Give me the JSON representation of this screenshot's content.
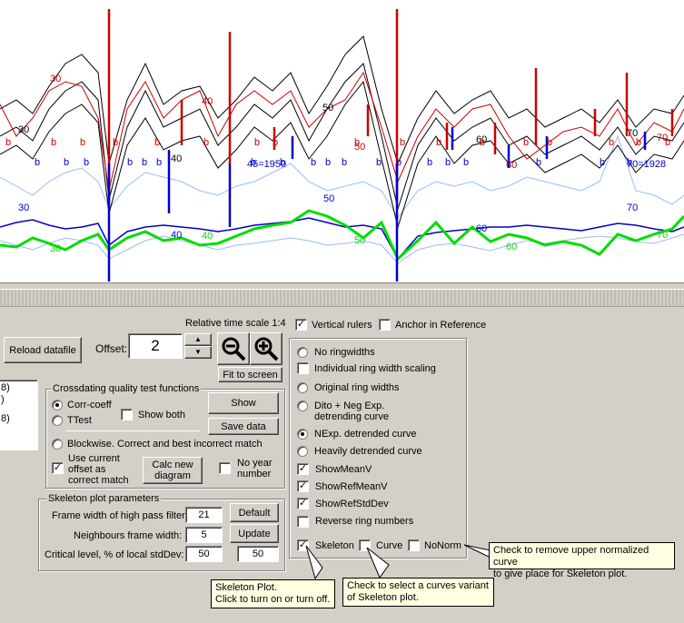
{
  "chart_data": {
    "type": "line",
    "rulers": {
      "red_spikes": 12,
      "blue_spikes": 9
    },
    "labels": {
      "decade_red": [
        "30",
        "40",
        "50",
        "60",
        "70"
      ],
      "decade_black": [
        "30",
        "40",
        "50",
        "60",
        "70"
      ],
      "decade_blue": [
        "30",
        "40",
        "50",
        "60",
        "70"
      ],
      "decade_green": [
        "30",
        "40",
        "50",
        "60",
        "70"
      ],
      "markers_b": "b",
      "ref_year_1": "45=1950",
      "ref_year_2": "70=1928"
    }
  },
  "header": {
    "time_scale": "Relative time scale 1:4",
    "vertical_rulers": "Vertical rulers",
    "anchor_in_reference": "Anchor in Reference"
  },
  "toolbar": {
    "reload_datafile": "Reload datafile",
    "offset_label": "Offset:",
    "offset_value": "2",
    "fit_to_screen": "Fit to screen"
  },
  "left_list": {
    "items": [
      "8)",
      ")",
      "8)"
    ]
  },
  "crossdating": {
    "title": "Crossdating quality test functions",
    "corr_coeff": "Corr-coeff",
    "ttest": "TTest",
    "show_both": "Show both",
    "show": "Show",
    "save_data": "Save data",
    "blockwise": "Blockwise. Correct and best incorrect match",
    "use_current_offset": "Use current offset as correct match",
    "calc_new_diagram": "Calc new diagram",
    "no_year_number": "No year number"
  },
  "skeleton": {
    "title": "Skeleton plot parameters",
    "frame_width_label": "Frame width of high pass filter:",
    "frame_width_value": "21",
    "default_button": "Default",
    "neighbours_label": "Neighbours frame width:",
    "neighbours_value": "5",
    "update_button": "Update",
    "critical_label": "Critical level, % of local stdDev:",
    "critical_value_1": "50",
    "critical_value_2": "50"
  },
  "options": {
    "no_ringwidths": "No ringwidths",
    "individual_scaling": "Individual ring width scaling",
    "original_ring_widths": "Original ring widths",
    "dito_neg_exp": "Dito + Neg Exp. detrending curve",
    "nexp_detrended": "NExp. detrended curve",
    "heavily_detrended": "Heavily detrended curve",
    "show_mean_v": "ShowMeanV",
    "show_ref_mean_v": "ShowRefMeanV",
    "show_ref_std_dev": "ShowRefStdDev",
    "reverse_ring_numbers": "Reverse ring numbers",
    "skeleton": "Skeleton",
    "curve": "Curve",
    "no_norm": "NoNorm"
  },
  "tooltips": {
    "skeleton_tip": "Skeleton Plot.\nClick to turn on or turn off.",
    "curve_tip": "Check to select a curves variant\nof Skeleton plot.",
    "nonorm_tip": "Check to remove upper normalized curve\nto give place for Skeleton plot."
  },
  "colors": {
    "red": "#cc0000",
    "blue": "#0000cc",
    "green": "#00dd00",
    "lightblue": "#99bbff",
    "black": "#000000"
  }
}
